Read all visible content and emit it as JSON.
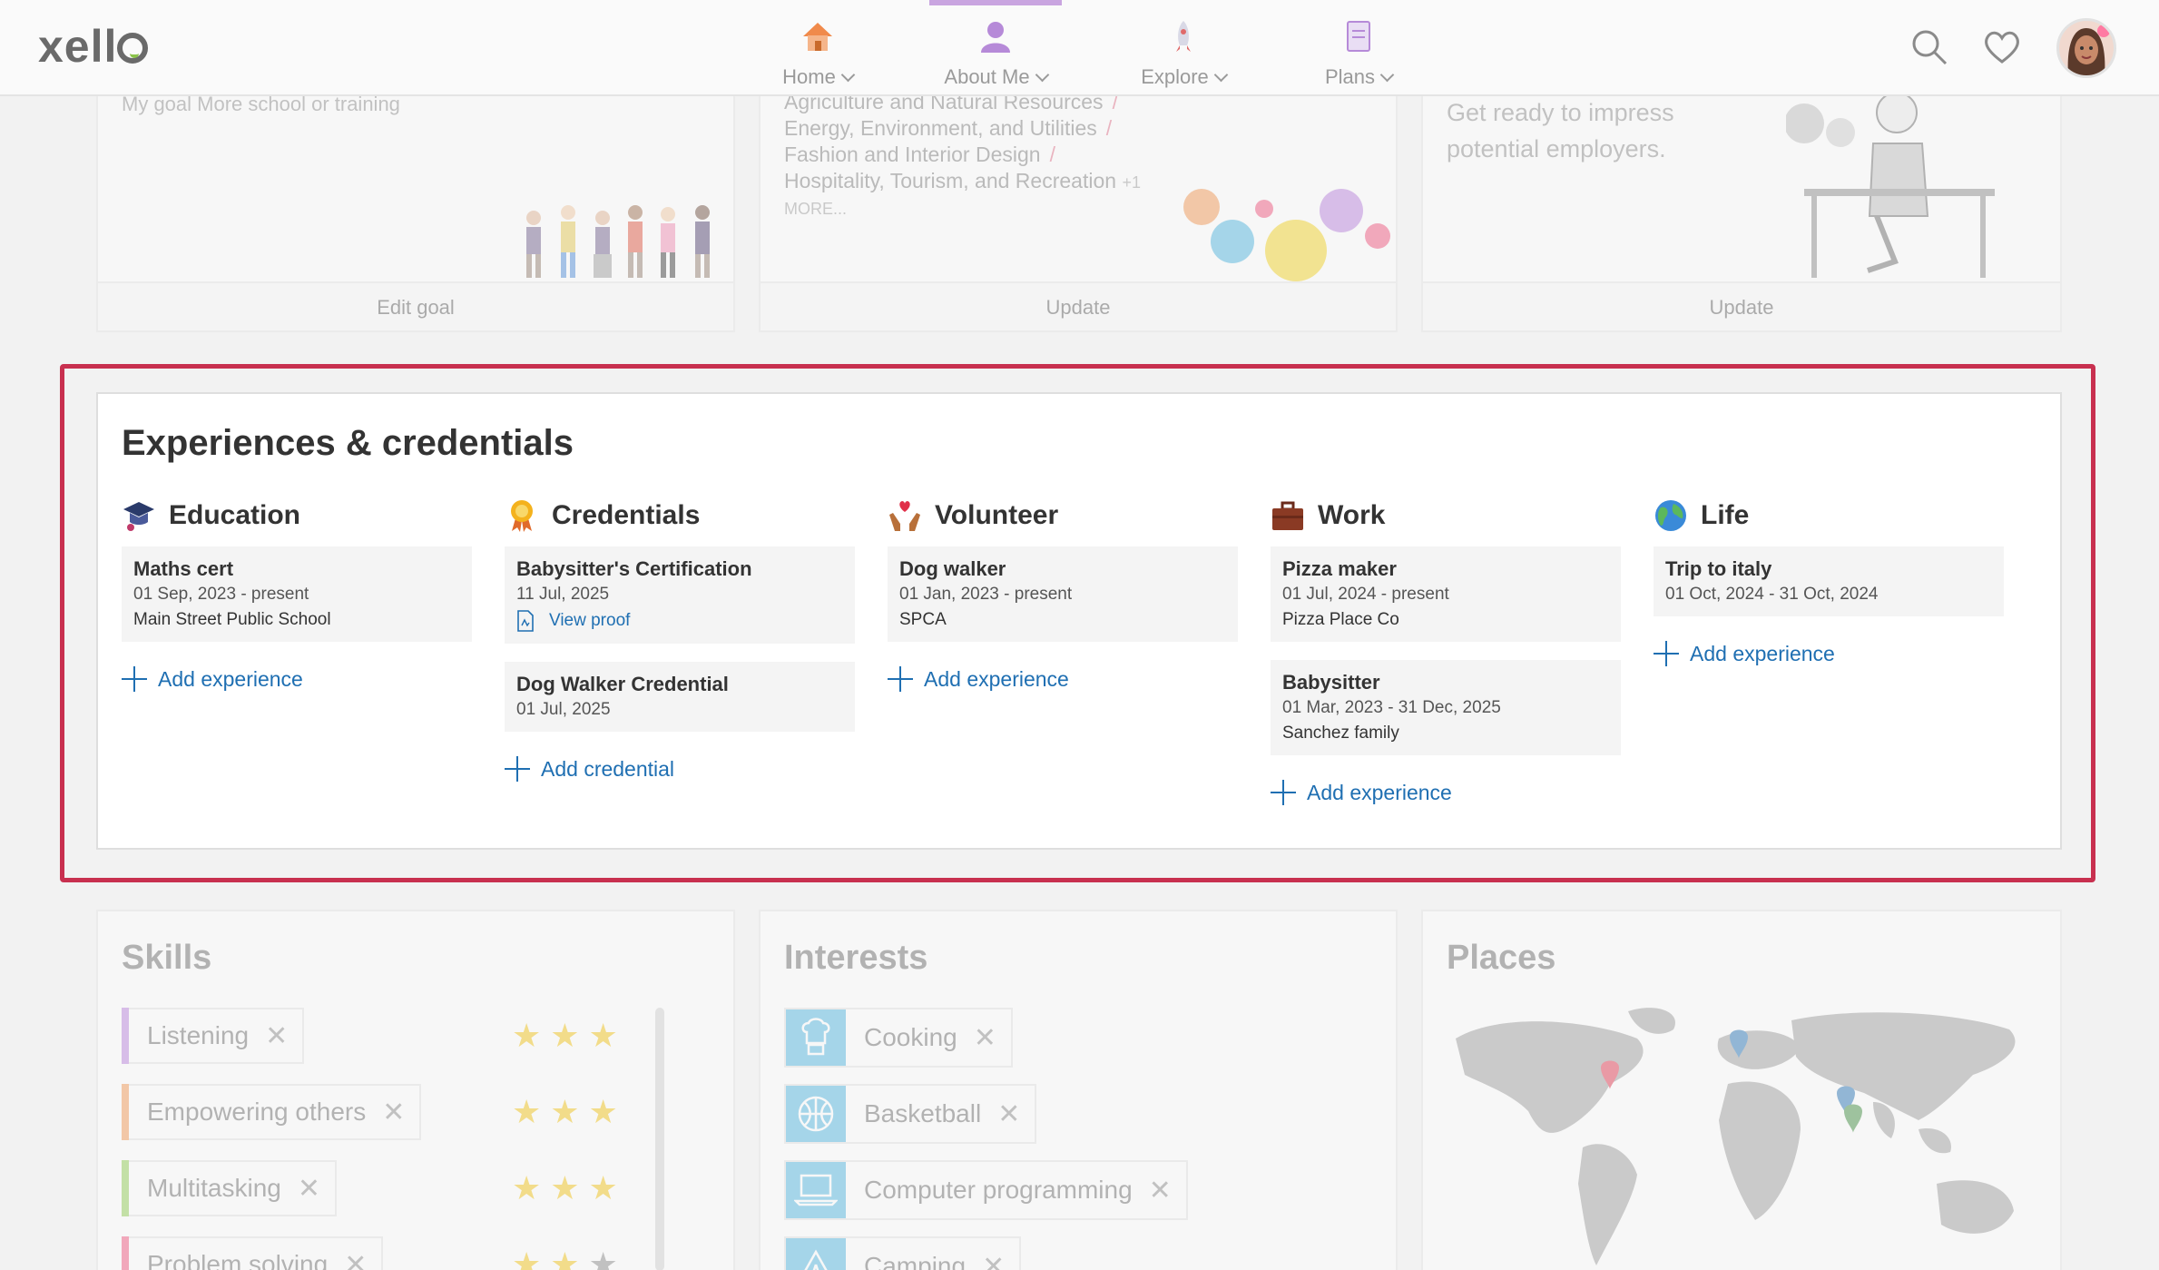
{
  "nav": {
    "logo": "xello",
    "items": [
      {
        "label": "Home",
        "icon": "house-icon"
      },
      {
        "label": "About Me",
        "icon": "person-icon"
      },
      {
        "label": "Explore",
        "icon": "rocket-icon"
      },
      {
        "label": "Plans",
        "icon": "clipboard-icon"
      }
    ],
    "active": "About Me"
  },
  "top_cards": {
    "goal": {
      "text": "My goal More school or training",
      "footer": "Edit goal"
    },
    "careers": {
      "items": [
        "Agriculture and Natural Resources",
        "Energy, Environment, and Utilities",
        "Fashion and Interior Design",
        "Hospitality, Tourism, and Recreation"
      ],
      "extra": "+1",
      "more": "MORE...",
      "footer": "Update"
    },
    "employers": {
      "text": "Get ready to impress potential employers.",
      "footer": "Update"
    }
  },
  "experiences": {
    "title": "Experiences & credentials",
    "columns": {
      "education": {
        "title": "Education",
        "entries": [
          {
            "title": "Maths cert",
            "dates": "01 Sep, 2023 - present",
            "org": "Main Street Public School"
          }
        ],
        "add": "Add experience"
      },
      "credentials": {
        "title": "Credentials",
        "entries": [
          {
            "title": "Babysitter's Certification",
            "dates": "11 Jul, 2025",
            "proof": "View proof"
          },
          {
            "title": "Dog Walker Credential",
            "dates": "01 Jul, 2025"
          }
        ],
        "add": "Add credential"
      },
      "volunteer": {
        "title": "Volunteer",
        "entries": [
          {
            "title": "Dog walker",
            "dates": "01 Jan, 2023 - present",
            "org": "SPCA"
          }
        ],
        "add": "Add experience"
      },
      "work": {
        "title": "Work",
        "entries": [
          {
            "title": "Pizza maker",
            "dates": "01 Jul, 2024 - present",
            "org": "Pizza Place Co"
          },
          {
            "title": "Babysitter",
            "dates": "01 Mar, 2023 - 31 Dec, 2025",
            "org": "Sanchez family"
          }
        ],
        "add": "Add experience"
      },
      "life": {
        "title": "Life",
        "entries": [
          {
            "title": "Trip to italy",
            "dates": "01 Oct, 2024 - 31 Oct, 2024"
          }
        ],
        "add": "Add experience"
      }
    }
  },
  "skills": {
    "title": "Skills",
    "items": [
      {
        "label": "Listening",
        "color": "#b77fdc",
        "rating": 3
      },
      {
        "label": "Empowering others",
        "color": "#f2944d",
        "rating": 3
      },
      {
        "label": "Multitasking",
        "color": "#8ccc4c",
        "rating": 3
      },
      {
        "label": "Problem solving",
        "color": "#f0507a",
        "rating": 2
      }
    ]
  },
  "interests": {
    "title": "Interests",
    "items": [
      {
        "label": "Cooking",
        "icon": "chef-icon"
      },
      {
        "label": "Basketball",
        "icon": "basketball-icon"
      },
      {
        "label": "Computer programming",
        "icon": "laptop-icon"
      },
      {
        "label": "Camping",
        "icon": "tent-icon"
      }
    ]
  },
  "places": {
    "title": "Places"
  },
  "colors": {
    "accent": "#1f6fb2",
    "highlight": "#c8304f",
    "star": "#f4c20d"
  }
}
